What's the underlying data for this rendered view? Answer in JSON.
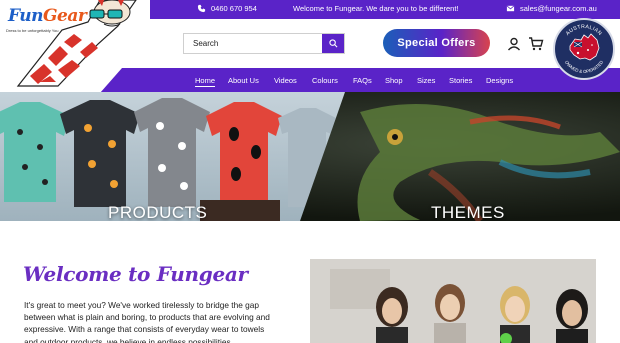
{
  "brand": {
    "name_part1": "Fun",
    "name_part2": "Gear",
    "tagline": "Dress to be unforgettably You"
  },
  "topbar": {
    "phone": "0460 670 954",
    "welcome": "Welcome to Fungear. We dare you to be different!",
    "email": "sales@fungear.com.au"
  },
  "search": {
    "placeholder": "Search"
  },
  "offers": {
    "label": "Special Offers"
  },
  "badge": {
    "text_top": "AUSTRALIAN",
    "text_bottom": "OWNED & OPERATED"
  },
  "nav": {
    "items": [
      {
        "label": "Home"
      },
      {
        "label": "About Us"
      },
      {
        "label": "Videos"
      },
      {
        "label": "Colours"
      },
      {
        "label": "FAQs"
      },
      {
        "label": "Shop"
      },
      {
        "label": "Sizes"
      },
      {
        "label": "Stories"
      },
      {
        "label": "Designs"
      }
    ]
  },
  "hero": {
    "left_label": "PRODUCTS",
    "right_label": "THEMES"
  },
  "welcome": {
    "title": "Welcome to Fungear",
    "body": "It's great to meet you? We've worked tirelessly to bridge the gap between what is plain and boring, to products that are evolving and expressive. With a range that consists of everyday wear to towels and outdoor products, we believe in endless possibilities."
  },
  "colors": {
    "accent": "#5a23c8",
    "brand_blue": "#1d5fc8",
    "brand_orange": "#e8581b",
    "welcome_purple": "#6a2ec2"
  }
}
